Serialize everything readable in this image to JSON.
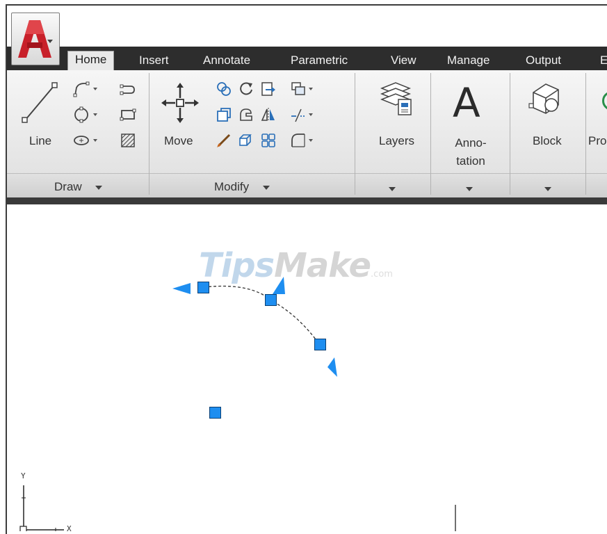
{
  "tabs": [
    "Home",
    "Insert",
    "Annotate",
    "Parametric",
    "View",
    "Manage",
    "Output",
    "E"
  ],
  "active_tab": "Home",
  "ribbon": {
    "buttons": {
      "line": "Line",
      "move": "Move",
      "layers": "Layers",
      "annotation": "Anno-\ntation",
      "block": "Block",
      "properties_partial": "Pro"
    },
    "panels": {
      "draw": "Draw",
      "modify": "Modify"
    }
  },
  "watermark": {
    "part1": "Tips",
    "part2": "Make",
    "part3": ".com"
  },
  "ucs": {
    "x_label": "X",
    "y_label": "Y"
  },
  "colors": {
    "tabbar": "#2d2d2d",
    "grip": "#1e8ef0",
    "app_red": "#c8202a",
    "ribbon": "#efefef"
  }
}
